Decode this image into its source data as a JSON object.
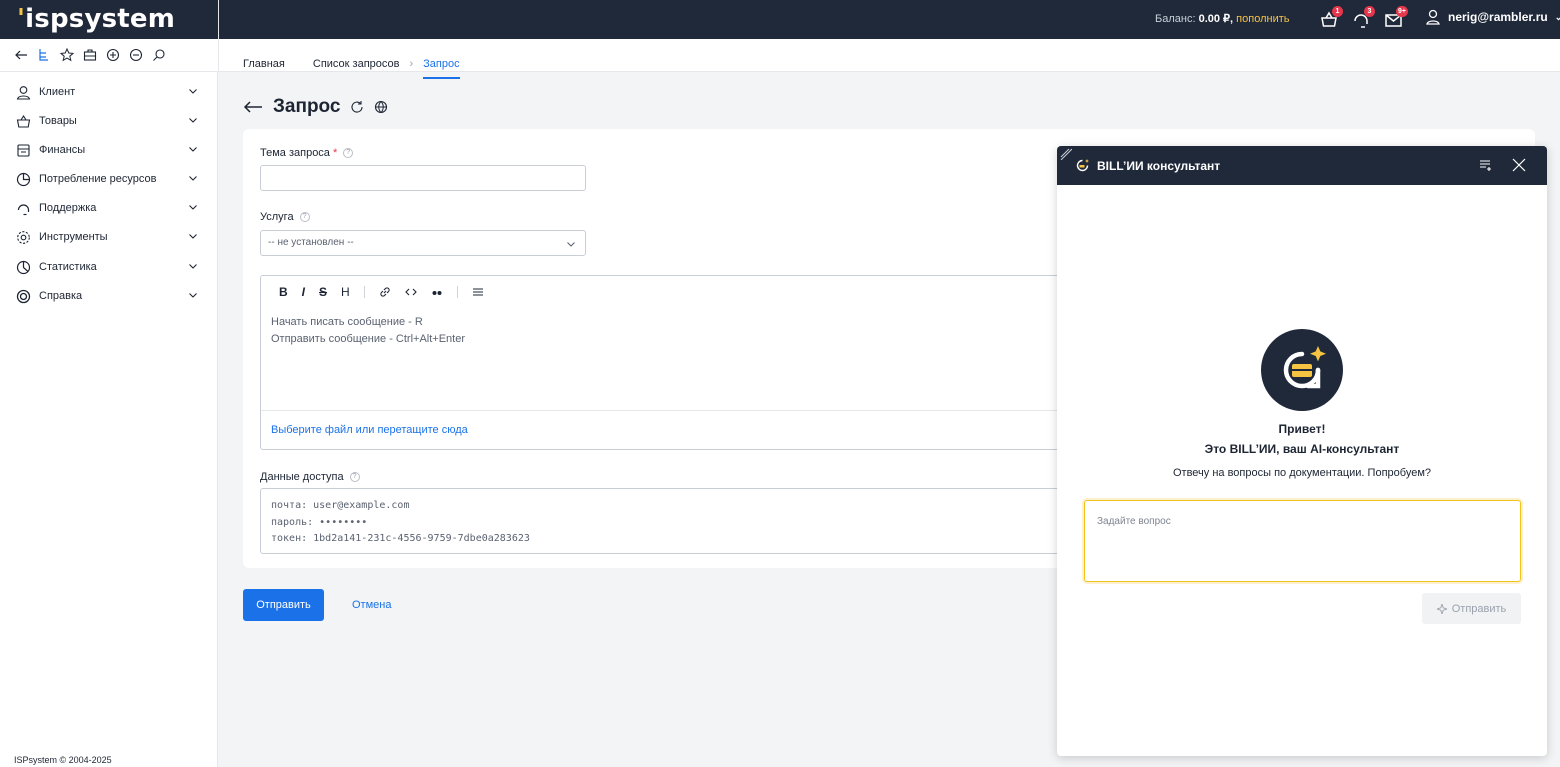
{
  "topbar": {
    "logo": "ispsystem",
    "balance_label": "Баланс:",
    "balance_value": "0.00 ₽,",
    "topup_label": "пополнить",
    "badges": {
      "cart": "1",
      "support": "3",
      "mail": "9+"
    },
    "user": "nerig@rambler.ru"
  },
  "breadcrumbs": {
    "home": "Главная",
    "list": "Список запросов",
    "current": "Запрос"
  },
  "sidebar": {
    "items": [
      {
        "label": "Клиент",
        "icon": "user-icon"
      },
      {
        "label": "Товары",
        "icon": "basket-icon"
      },
      {
        "label": "Финансы",
        "icon": "finance-icon"
      },
      {
        "label": "Потребление ресурсов",
        "icon": "pie-icon"
      },
      {
        "label": "Поддержка",
        "icon": "headset-icon"
      },
      {
        "label": "Инструменты",
        "icon": "gear-icon"
      },
      {
        "label": "Статистика",
        "icon": "chart-icon"
      },
      {
        "label": "Справка",
        "icon": "lifebuoy-icon"
      }
    ],
    "footer": "ISPsystem © 2004-2025"
  },
  "page": {
    "title": "Запрос",
    "subject_label": "Тема запроса",
    "subject_required": "*",
    "subject_value": "",
    "service_label": "Услуга",
    "service_value": "-- не установлен --",
    "editor": {
      "toolbar": [
        "B",
        "I",
        "S",
        "H"
      ],
      "hint1": "Начать писать сообщение - R",
      "hint2": "Отправить сообщение - Ctrl+Alt+Enter",
      "file_link": "Выберите файл или перетащите сюда"
    },
    "access_label": "Данные доступа",
    "access_lines": [
      "почта: user@example.com",
      "пароль: ••••••••",
      "токен: 1bd2a141-231c-4556-9759-7dbe0a283623"
    ],
    "submit": "Отправить",
    "cancel": "Отмена"
  },
  "chat": {
    "title": "BILL’ИИ консультант",
    "greeting1": "Привет!",
    "greeting2": "Это BILL’ИИ, ваш AI-консультант",
    "subtitle": "Отвечу на вопросы по документации. Попробуем?",
    "input_placeholder": "Задайте вопрос",
    "send": "Отправить"
  },
  "colors": {
    "topbar": "#20293a",
    "accent": "#1b72e8",
    "yellow": "#f6c343"
  }
}
